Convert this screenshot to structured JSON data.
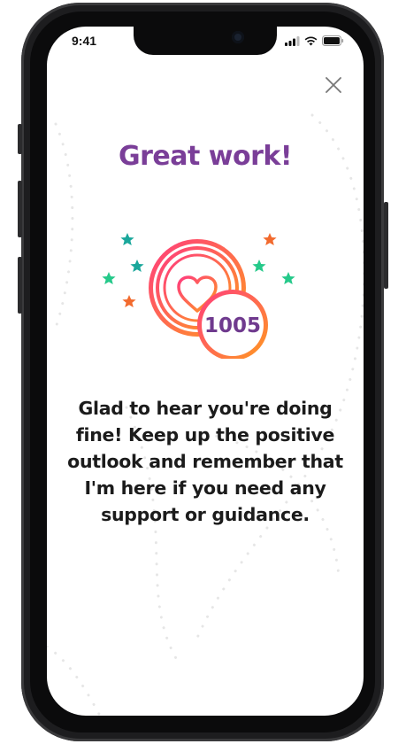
{
  "status_bar": {
    "time": "9:41"
  },
  "dialog": {
    "close_icon": "close-icon",
    "title": "Great work!",
    "points": "1005",
    "message": "Glad to hear you're doing fine! Keep up the positive outlook and remember that I'm here if you need any support or guidance."
  },
  "colors": {
    "title": "#7a3e98",
    "points_text": "#6f3a8e",
    "medal_gradient_start": "#ff3c7e",
    "medal_gradient_end": "#ff9a1f",
    "star_teal": "#1aa79b",
    "star_green": "#25c98a",
    "star_orange": "#f26a2e",
    "message_text": "#1b1b1b"
  },
  "icons": [
    "signal-icon",
    "wifi-icon",
    "battery-icon",
    "close-icon",
    "heart-icon",
    "star-icon"
  ]
}
